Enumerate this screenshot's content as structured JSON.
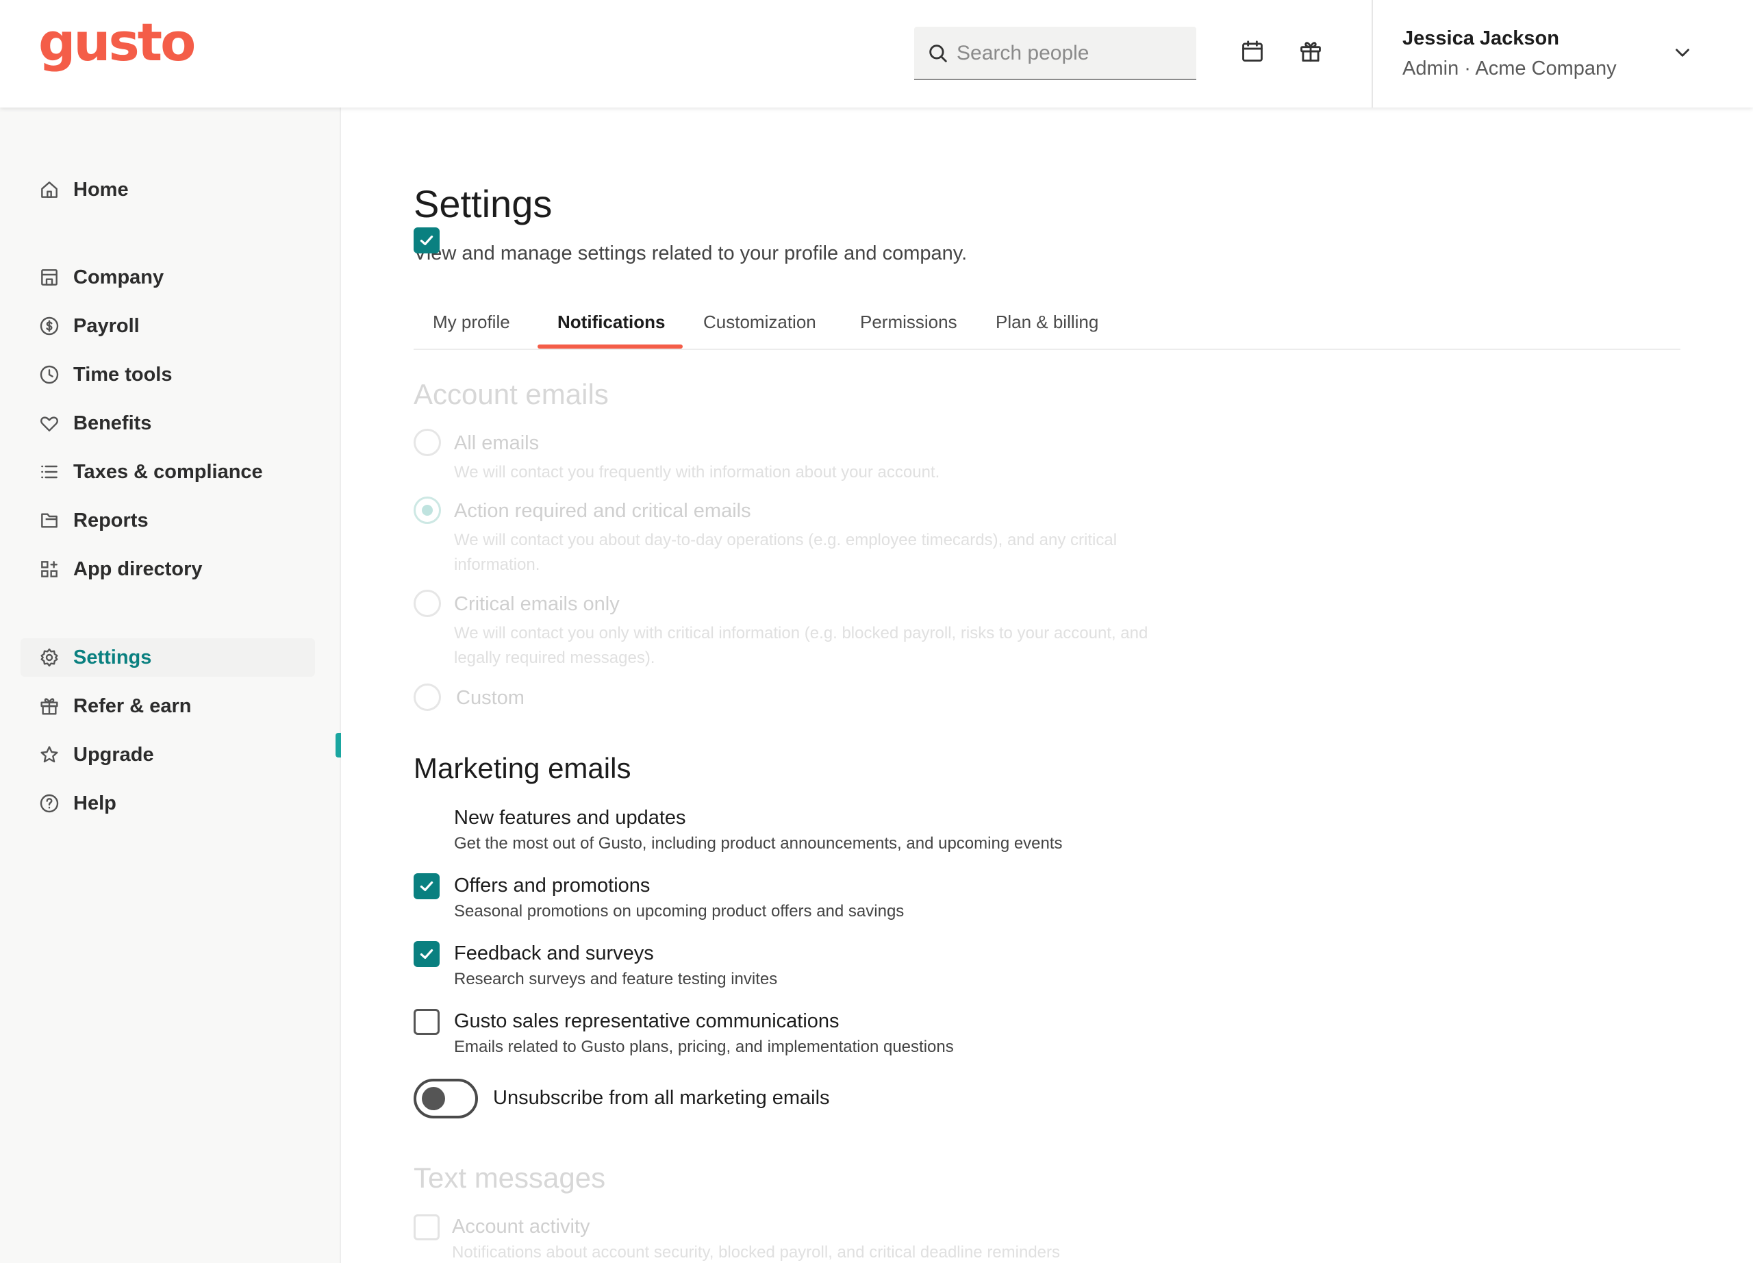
{
  "brand": {
    "logo_text": "gusto",
    "accent": "#f45d48",
    "teal": "#0a8080"
  },
  "header": {
    "search_placeholder": "Search people",
    "calendar_icon": "calendar-icon",
    "gift_icon": "gift-icon",
    "user_name": "Jessica Jackson",
    "user_role": "Admin · Acme Company"
  },
  "sidebar": {
    "items": [
      {
        "label": "Home",
        "icon": "home-icon"
      },
      {
        "label": "Company",
        "icon": "building-icon"
      },
      {
        "label": "Payroll",
        "icon": "dollar-circle-icon"
      },
      {
        "label": "Time tools",
        "icon": "clock-icon"
      },
      {
        "label": "Benefits",
        "icon": "heart-icon"
      },
      {
        "label": "Taxes & compliance",
        "icon": "list-icon"
      },
      {
        "label": "Reports",
        "icon": "folder-icon"
      },
      {
        "label": "App directory",
        "icon": "apps-icon"
      },
      {
        "label": "Settings",
        "icon": "gear-icon",
        "active": true
      },
      {
        "label": "Refer & earn",
        "icon": "gift-icon"
      },
      {
        "label": "Upgrade",
        "icon": "star-icon"
      },
      {
        "label": "Help",
        "icon": "help-circle-icon"
      }
    ]
  },
  "page": {
    "title": "Settings",
    "subtitle": "View and manage settings related to your profile and company.",
    "tabs": [
      {
        "label": "My profile"
      },
      {
        "label": "Notifications",
        "active": true
      },
      {
        "label": "Customization"
      },
      {
        "label": "Permissions"
      },
      {
        "label": "Plan & billing"
      }
    ]
  },
  "account_emails": {
    "title": "Account emails",
    "options": [
      {
        "label": "All emails",
        "desc": [
          "We will contact you frequently with information about your account."
        ],
        "checked": false
      },
      {
        "label": "Action required and critical emails",
        "desc": [
          "We will contact you about day-to-day operations (e.g. employee timecards), and any critical",
          "information."
        ],
        "checked": true
      },
      {
        "label": "Critical emails only",
        "desc": [
          "We will contact you only with critical information (e.g. blocked payroll, risks to your account, and",
          "legally required messages)."
        ],
        "checked": false
      },
      {
        "label": "Custom",
        "desc": [],
        "checked": false
      }
    ]
  },
  "marketing_emails": {
    "title": "Marketing emails",
    "options": [
      {
        "label": "New features and updates",
        "desc": "Get the most out of Gusto, including product announcements, and upcoming events",
        "checked": true
      },
      {
        "label": "Offers and promotions",
        "desc": "Seasonal promotions on upcoming product offers and savings",
        "checked": true
      },
      {
        "label": "Feedback and surveys",
        "desc": "Research surveys and feature testing invites",
        "checked": true
      },
      {
        "label": "Gusto sales representative communications",
        "desc": "Emails related to Gusto plans, pricing, and implementation questions",
        "checked": false
      }
    ],
    "unsubscribe_label": "Unsubscribe from all marketing emails",
    "unsubscribe_on": false
  },
  "text_messages": {
    "title": "Text messages",
    "options": [
      {
        "label": "Account activity",
        "desc": "Notifications about account security, blocked payroll, and critical deadline reminders",
        "checked": false
      }
    ]
  }
}
